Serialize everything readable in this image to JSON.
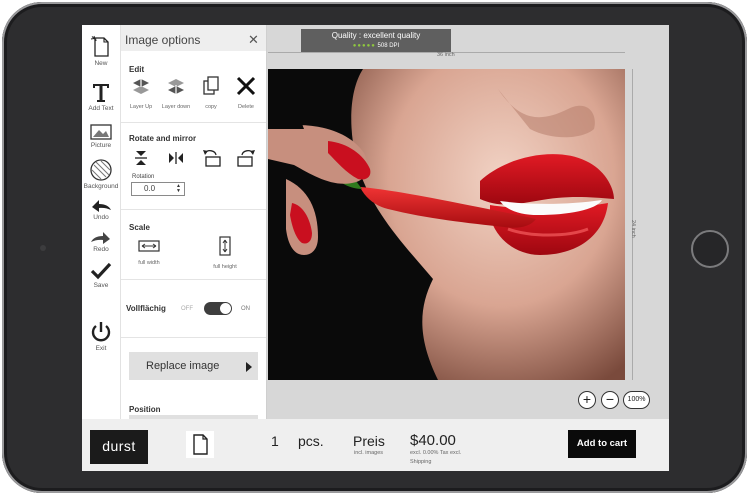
{
  "toolbar": {
    "items": [
      {
        "label": "New",
        "icon": "new-file-icon"
      },
      {
        "label": "Add Text",
        "icon": "text-icon"
      },
      {
        "label": "Picture",
        "icon": "picture-icon"
      },
      {
        "label": "Background",
        "icon": "background-icon"
      },
      {
        "label": "Undo",
        "icon": "undo-icon"
      },
      {
        "label": "Redo",
        "icon": "redo-icon"
      },
      {
        "label": "Save",
        "icon": "checkmark-icon"
      },
      {
        "label": "Exit",
        "icon": "power-icon"
      }
    ]
  },
  "panel": {
    "title": "Image options",
    "close_icon": "close-icon",
    "edit": {
      "title": "Edit",
      "buttons": [
        {
          "label": "Layer Up",
          "icon": "layer-up-icon"
        },
        {
          "label": "Layer down",
          "icon": "layer-down-icon"
        },
        {
          "label": "copy",
          "icon": "copy-icon"
        },
        {
          "label": "Delete",
          "icon": "delete-icon"
        }
      ]
    },
    "rotate": {
      "title": "Rotate and mirror",
      "buttons": [
        {
          "icon": "flip-vertical-icon"
        },
        {
          "icon": "flip-horizontal-icon"
        },
        {
          "icon": "rotate-left-icon"
        },
        {
          "icon": "rotate-right-icon"
        }
      ],
      "rotation_label": "Rotation",
      "rotation_value": "0.0"
    },
    "scale": {
      "title": "Scale",
      "buttons": [
        {
          "label": "full width",
          "icon": "full-width-icon"
        },
        {
          "label": "full height",
          "icon": "full-height-icon"
        }
      ]
    },
    "fill": {
      "title": "Vollflächig",
      "off_label": "OFF",
      "on_label": "ON",
      "state": "on"
    },
    "replace_label": "Replace image",
    "position_title": "Position"
  },
  "canvas": {
    "quality_text": "Quality : excellent quality",
    "quality_dpi": "508 DPI",
    "quality_dots": "●●●●●",
    "width_label": "36 inch",
    "height_label": "24 inch"
  },
  "zoom": {
    "in_label": "+",
    "out_label": "−",
    "level": "100%"
  },
  "footer": {
    "logo": "durst",
    "quantity": "1",
    "unit": "pcs.",
    "price_label": "Preis",
    "price_sub": "incl. images",
    "price": "$40.00",
    "tax_note": "excl. 0.00% Tax excl.",
    "shipping": "Shipping",
    "cart_label": "Add to cart"
  },
  "colors": {
    "quality_dots": "#8ec63f",
    "cart_button": "#0a0a0a",
    "toggle": "#3e3e3e"
  }
}
